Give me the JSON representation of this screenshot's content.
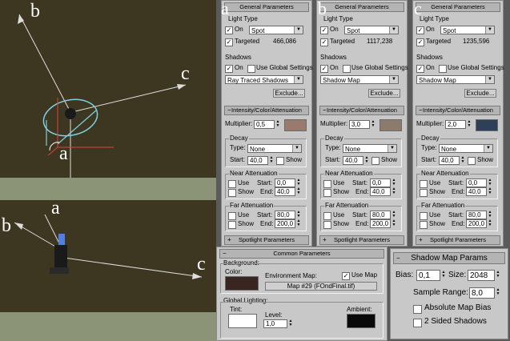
{
  "viewport_top": {
    "labels": [
      "b",
      "c",
      "a"
    ]
  },
  "viewport_bottom": {
    "labels": [
      "a",
      "b",
      "c"
    ]
  },
  "panels": [
    {
      "letter": "a",
      "header": "General Parameters",
      "light_type_label": "Light Type",
      "on_label": "On",
      "type_value": "Spot",
      "targeted_label": "Targeted",
      "targeted_value": "466,086",
      "shadows_label": "Shadows",
      "shadows_on_label": "On",
      "use_global_label": "Use Global Settings",
      "shadow_type": "Ray Traced Shadows",
      "exclude_label": "Exclude...",
      "intensity_header": "Intensity/Color/Attenuation",
      "multiplier_label": "Multiplier:",
      "multiplier_value": "0,5",
      "color": "#9a7a6c",
      "decay_label": "Decay",
      "decay_type_label": "Type:",
      "decay_type": "None",
      "decay_start_label": "Start:",
      "decay_start": "40,0",
      "show_label": "Show",
      "near_label": "Near Attenuation",
      "far_label": "Far Attenuation",
      "use_label": "Use",
      "start_label": "Start:",
      "end_label": "End:",
      "near_start": "0,0",
      "near_end": "40,0",
      "far_start": "80,0",
      "far_end": "200,0",
      "spot_header": "Spotlight Parameters"
    },
    {
      "letter": "b",
      "header": "General Parameters",
      "light_type_label": "Light Type",
      "on_label": "On",
      "type_value": "Spot",
      "targeted_label": "Targeted",
      "targeted_value": "1117,238",
      "shadows_label": "Shadows",
      "shadows_on_label": "On",
      "use_global_label": "Use Global Settings",
      "shadow_type": "Shadow Map",
      "exclude_label": "Exclude...",
      "intensity_header": "Intensity/Color/Attenuation",
      "multiplier_label": "Multiplier:",
      "multiplier_value": "3,0",
      "color": "#8c7a6c",
      "decay_label": "Decay",
      "decay_type_label": "Type:",
      "decay_type": "None",
      "decay_start_label": "Start:",
      "decay_start": "40,0",
      "show_label": "Show",
      "near_label": "Near Attenuation",
      "far_label": "Far Attenuation",
      "use_label": "Use",
      "start_label": "Start:",
      "end_label": "End:",
      "near_start": "0,0",
      "near_end": "40,0",
      "far_start": "80,0",
      "far_end": "200,0",
      "spot_header": "Spotlight Parameters"
    },
    {
      "letter": "c",
      "header": "General Parameters",
      "light_type_label": "Light Type",
      "on_label": "On",
      "type_value": "Spot",
      "targeted_label": "Targeted",
      "targeted_value": "1235,596",
      "shadows_label": "Shadows",
      "shadows_on_label": "On",
      "use_global_label": "Use Global Settings",
      "shadow_type": "Shadow Map",
      "exclude_label": "Exclude...",
      "intensity_header": "Intensity/Color/Attenuation",
      "multiplier_label": "Multiplier:",
      "multiplier_value": "2,0",
      "color": "#2e3f5a",
      "decay_label": "Decay",
      "decay_type_label": "Type:",
      "decay_type": "None",
      "decay_start_label": "Start:",
      "decay_start": "40,0",
      "show_label": "Show",
      "near_label": "Near Attenuation",
      "far_label": "Far Attenuation",
      "use_label": "Use",
      "start_label": "Start:",
      "end_label": "End:",
      "near_start": "0,0",
      "near_end": "40,0",
      "far_start": "80,0",
      "far_end": "200,0",
      "spot_header": "Spotlight Parameters"
    }
  ],
  "common": {
    "header": "Common Parameters",
    "background_label": "Background:",
    "color_label": "Color:",
    "bg_color": "#3a2620",
    "env_map_label": "Environment Map:",
    "use_map_label": "Use Map",
    "map_button": "Map #29 (FOndFinal.tif)",
    "global_lighting_label": "Global Lighting:",
    "tint_label": "Tint:",
    "tint_color": "#ffffff",
    "level_label": "Level:",
    "level_value": "1,0",
    "ambient_label": "Ambient:",
    "ambient_color": "#0a0a0a"
  },
  "shadow_map": {
    "header": "Shadow Map Params",
    "bias_label": "Bias:",
    "bias_value": "0,1",
    "size_label": "Size:",
    "size_value": "2048",
    "sample_range_label": "Sample Range:",
    "sample_range_value": "8,0",
    "absolute_label": "Absolute Map Bias",
    "two_sided_label": "2 Sided Shadows"
  }
}
